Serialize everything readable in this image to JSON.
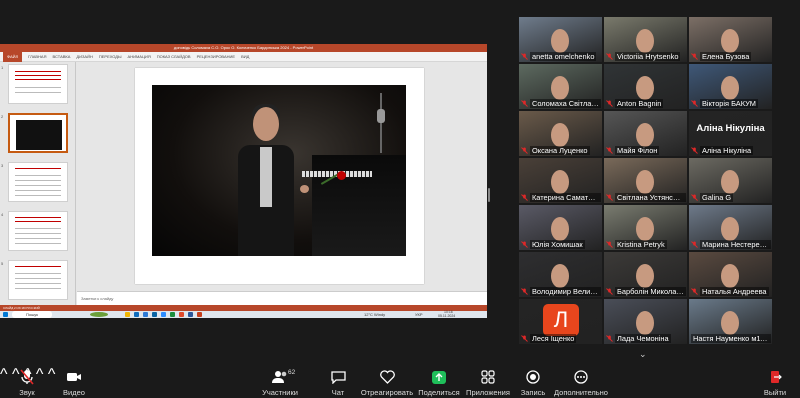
{
  "ppt": {
    "title": "доповідь Соломаха С.О. Орос О. Коляченко Бардинська 2024 - PowerPoint",
    "menu": [
      "ФАЙЛ",
      "ГЛАВНАЯ",
      "ВСТАВКА",
      "ДИЗАЙН",
      "ПЕРЕХОДЫ",
      "АНИМАЦИЯ",
      "ПОКАЗ СЛАЙДОВ",
      "РЕЦЕНЗИРОВАНИЕ",
      "ВИД"
    ],
    "notes_placeholder": "Заметки к слайду",
    "status": "СЛАЙД 2 ИЗ 18    РУССКИЙ",
    "weather": "12°C  Windy",
    "taskbar_search": "Пошук",
    "clock": "10:16",
    "date": "05.11.2024",
    "lang": "УКР"
  },
  "tiles": [
    {
      "name": "anetta omelchenko",
      "muted": true,
      "bg": "#6f7c8c"
    },
    {
      "name": "Victoriia Hrytsenko",
      "muted": true,
      "bg": "#7a7a6c"
    },
    {
      "name": "Елена Бузова",
      "muted": true,
      "bg": "#7c6f66"
    },
    {
      "name": "Соломаха Світлана",
      "muted": true,
      "bg": "#5d6a60",
      "active": true
    },
    {
      "name": "Anton Bagnin",
      "muted": true,
      "bg": "#303436"
    },
    {
      "name": "Вікторія БАКУМ",
      "muted": true,
      "bg": "#3f5878"
    },
    {
      "name": "Оксана Луценко",
      "muted": true,
      "bg": "#6a5a4a"
    },
    {
      "name": "Майя Філон",
      "muted": true,
      "bg": "#565656"
    },
    {
      "name": "Аліна Нікуліна",
      "muted": true,
      "bg": "#242424",
      "big": "Аліна Нікуліна"
    },
    {
      "name": "Катерина Саматова",
      "muted": true,
      "bg": "#4a4038"
    },
    {
      "name": "Світлана Устянська",
      "muted": true,
      "bg": "#7a6a5a"
    },
    {
      "name": "Galina G",
      "muted": true,
      "bg": "#6c6a62"
    },
    {
      "name": "Юлія Хомишак",
      "muted": true,
      "bg": "#5a5a66"
    },
    {
      "name": "Kristina Petryk",
      "muted": true,
      "bg": "#7a7c70"
    },
    {
      "name": "Марина Нестеренко",
      "muted": true,
      "bg": "#6e7a8a"
    },
    {
      "name": "Володимир Величко",
      "muted": true,
      "bg": "#2e2e30"
    },
    {
      "name": "Барболін Микола Оле...",
      "muted": true,
      "bg": "#3c3a38"
    },
    {
      "name": "Наталья Андреева",
      "muted": true,
      "bg": "#5a4a40"
    },
    {
      "name": "Леся Іщенко",
      "muted": true,
      "bg": "#242424",
      "avatar": "Л"
    },
    {
      "name": "Лада Чемоніна",
      "muted": true,
      "bg": "#4a4e58"
    },
    {
      "name": "Настя Науменко м11...",
      "muted": false,
      "bg": "#6a7a8a"
    }
  ],
  "toolbar": {
    "audio": "Звук",
    "video": "Видео",
    "participants": "Участники",
    "participants_count": "62",
    "chat": "Чат",
    "react": "Отреагировать",
    "share": "Поделиться",
    "apps": "Приложения",
    "record": "Запись",
    "more": "Дополнительно",
    "leave": "Выйти"
  }
}
